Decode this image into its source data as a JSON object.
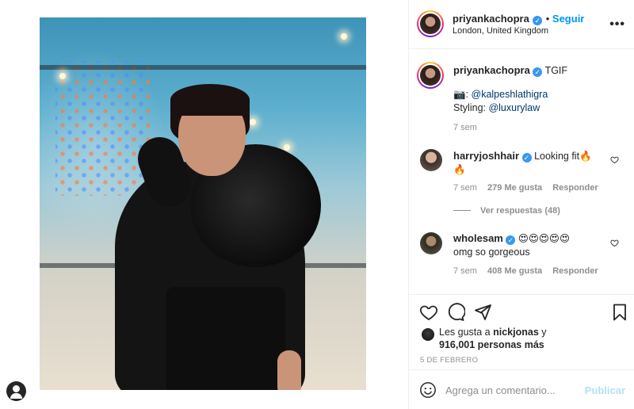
{
  "post": {
    "author": "priyankachopra",
    "follow_label": "Seguir",
    "location": "London, United Kingdom",
    "more_label": "•••"
  },
  "caption": {
    "username": "priyankachopra",
    "text": "TGIF",
    "credit_prefix": "📷: ",
    "credit_handle": "@kalpeshlathigra",
    "styling_prefix": "Styling: ",
    "styling_handle": "@luxurylaw",
    "time": "7 sem"
  },
  "comments": [
    {
      "username": "harryjoshhair",
      "text": "Looking fit🔥",
      "text_line2": "🔥",
      "time": "7 sem",
      "likes": "279 Me gusta",
      "reply_label": "Responder",
      "view_replies": "Ver respuestas (48)"
    },
    {
      "username": "wholesam",
      "text": "😍😍😍😍😍",
      "text_line2": "omg so gorgeous",
      "time": "7 sem",
      "likes": "408 Me gusta",
      "reply_label": "Responder"
    }
  ],
  "likes": {
    "prefix": "Les gusta a ",
    "liker": "nickjonas",
    "connector": " y",
    "count": "916,001 personas más"
  },
  "date": "5 DE FEBRERO",
  "add_comment": {
    "placeholder": "Agrega un comentario...",
    "publish_label": "Publicar"
  },
  "colors": {
    "accent": "#0095f6",
    "verified": "#3897f0",
    "muted": "#8e8e8e",
    "publish_disabled": "#b2dffc"
  }
}
